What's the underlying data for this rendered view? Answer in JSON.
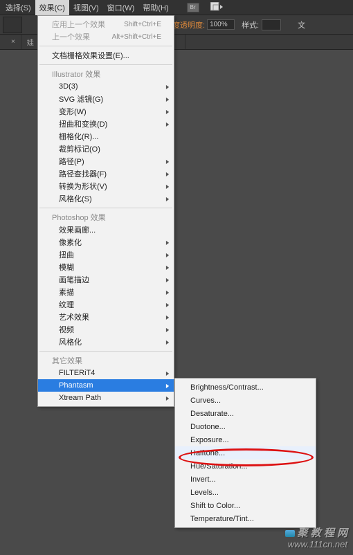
{
  "menubar": {
    "items": [
      "选择(S)",
      "效果(C)",
      "视图(V)",
      "窗口(W)",
      "帮助(H)"
    ],
    "br": "Br"
  },
  "toolbar": {
    "opacity_label": "度透明度:",
    "opacity_value": "100%",
    "style_label": "样式:",
    "doc_label": "文"
  },
  "tabs": {
    "t0": "",
    "t1": "娃"
  },
  "menu": {
    "apply_last": "应用上一个效果",
    "apply_last_key": "Shift+Ctrl+E",
    "last": "上一个效果",
    "last_key": "Alt+Shift+Ctrl+E",
    "doc_raster": "文档栅格效果设置(E)...",
    "il_header": "Illustrator 效果",
    "il": [
      "3D(3)",
      "SVG 滤镜(G)",
      "变形(W)",
      "扭曲和变换(D)",
      "栅格化(R)...",
      "裁剪标记(O)",
      "路径(P)",
      "路径查找器(F)",
      "转换为形状(V)",
      "风格化(S)"
    ],
    "il_sub": [
      true,
      true,
      true,
      true,
      false,
      false,
      true,
      true,
      true,
      true
    ],
    "ps_header": "Photoshop 效果",
    "ps": [
      "效果画廊...",
      "像素化",
      "扭曲",
      "模糊",
      "画笔描边",
      "素描",
      "纹理",
      "艺术效果",
      "视频",
      "风格化"
    ],
    "ps_sub": [
      false,
      true,
      true,
      true,
      true,
      true,
      true,
      true,
      true,
      true
    ],
    "other_header": "其它效果",
    "other": [
      "FILTERiT4",
      "Phantasm",
      "Xtream Path"
    ]
  },
  "submenu": {
    "items": [
      "Brightness/Contrast...",
      "Curves...",
      "Desaturate...",
      "Duotone...",
      "Exposure...",
      "Halftone...",
      "Hue/Saturation...",
      "Invert...",
      "Levels...",
      "Shift to Color...",
      "Temperature/Tint..."
    ]
  },
  "watermark": {
    "row1": "聚 教 程 网",
    "row2": "www.111cn.net"
  }
}
